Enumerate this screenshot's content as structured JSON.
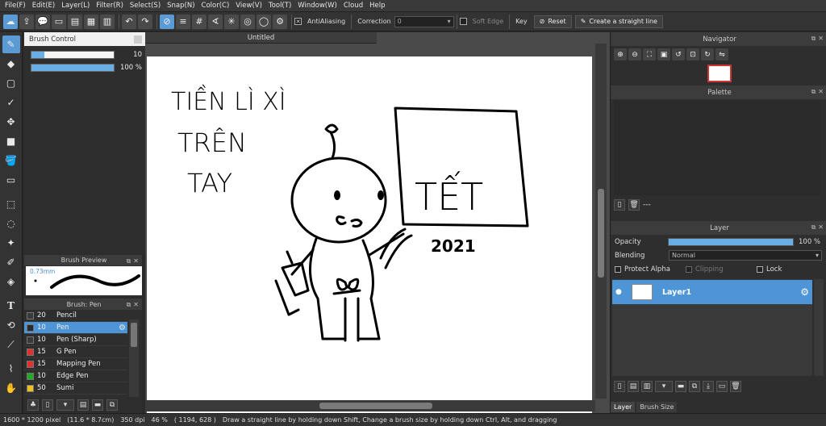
{
  "menu": [
    "File(F)",
    "Edit(E)",
    "Layer(L)",
    "Filter(R)",
    "Select(S)",
    "Snap(N)",
    "Color(C)",
    "View(V)",
    "Tool(T)",
    "Window(W)",
    "Cloud",
    "Help"
  ],
  "toolbar": {
    "antialiasing_label": "AntiAliasing",
    "correction_label": "Correction",
    "correction_value": "0",
    "soft_edge_label": "Soft Edge",
    "key_label": "Key",
    "reset_label": "Reset",
    "straight_line_label": "Create a straight line"
  },
  "brush_control": {
    "title": "Brush Control",
    "size_value": "10",
    "size_fraction": 0.16,
    "opacity_value": "100 %",
    "opacity_fraction": 1.0
  },
  "brush_preview": {
    "title": "Brush Preview",
    "size_text": "0.73mm"
  },
  "brush_list": {
    "title": "Brush: Pen",
    "items": [
      {
        "size": "20",
        "name": "Pencil",
        "color": "#3a3a3a",
        "selected": false
      },
      {
        "size": "10",
        "name": "Pen",
        "color": "#2a2a2a",
        "selected": true
      },
      {
        "size": "10",
        "name": "Pen (Sharp)",
        "color": "#3a3a3a",
        "selected": false
      },
      {
        "size": "15",
        "name": "G Pen",
        "color": "#e03030",
        "selected": false
      },
      {
        "size": "15",
        "name": "Mapping Pen",
        "color": "#e03030",
        "selected": false
      },
      {
        "size": "10",
        "name": "Edge Pen",
        "color": "#22aa22",
        "selected": false
      },
      {
        "size": "50",
        "name": "Sumi",
        "color": "#f0c020",
        "selected": false
      }
    ]
  },
  "canvas": {
    "tab_title": "Untitled",
    "drawing_text": {
      "line1": "TIỀN LÌ XÌ",
      "line2": "TRÊN",
      "line3": "TAY",
      "sign_main": "TẾT",
      "sign_year": "2021"
    }
  },
  "navigator": {
    "title": "Navigator"
  },
  "palette": {
    "title": "Palette",
    "placeholder": "---"
  },
  "layer": {
    "title": "Layer",
    "opacity_label": "Opacity",
    "opacity_value": "100 %",
    "blending_label": "Blending",
    "blending_value": "Normal",
    "protect_alpha_label": "Protect Alpha",
    "clipping_label": "Clipping",
    "lock_label": "Lock",
    "layer_name": "Layer1"
  },
  "bottom_tabs": [
    "Layer",
    "Brush Size"
  ],
  "status": {
    "size": "1600 * 1200 pixel",
    "physical": "(11.6 * 8.7cm)",
    "dpi": "350 dpi",
    "zoom": "46 %",
    "coords": "( 1194, 628 )",
    "hint": "Draw a straight line by holding down Shift, Change a brush size by holding down Ctrl, Alt, and dragging"
  },
  "colors": {
    "accent": "#4d95d6",
    "slider": "#6aaee6",
    "panel_bg": "#2e2e2e"
  }
}
